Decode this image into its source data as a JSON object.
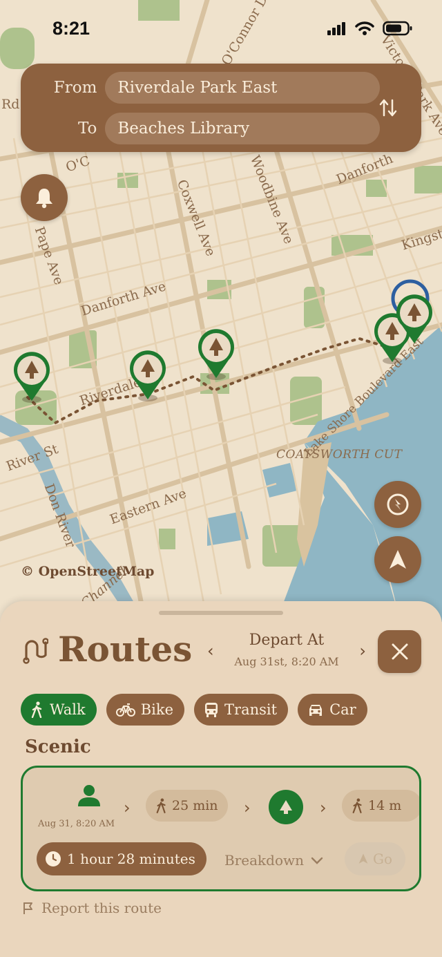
{
  "status": {
    "time": "8:21"
  },
  "route_form": {
    "from_label": "From",
    "from_value": "Riverdale Park East",
    "to_label": "To",
    "to_value": "Beaches Library"
  },
  "map": {
    "attribution": "© OpenStreetMap",
    "street_labels": [
      "Danforth Ave",
      "Coxwell Ave",
      "Danforth",
      "Kingston",
      "Riverdale",
      "River St",
      "Don River",
      "Eastern Ave",
      "Lake Shore Boulevard East",
      "COATSWORTH CUT",
      "Channel",
      "Pape Ave",
      "Woodbine Ave",
      "O'Connor Dr",
      "Victoria Park Ave",
      "Rd",
      "O'C"
    ]
  },
  "sheet": {
    "title": "Routes",
    "depart_title": "Depart At",
    "depart_time": "Aug 31st, 8:20 AM",
    "modes": [
      {
        "label": "Walk",
        "icon": "walk-icon",
        "active": true
      },
      {
        "label": "Bike",
        "icon": "bike-icon",
        "active": false
      },
      {
        "label": "Transit",
        "icon": "bus-icon",
        "active": false
      },
      {
        "label": "Car",
        "icon": "car-icon",
        "active": false
      }
    ],
    "section_label": "Scenic",
    "card": {
      "start_time": "Aug 31, 8:20 AM",
      "leg1": "25 min",
      "leg2": "14 m",
      "duration": "1 hour 28 minutes",
      "breakdown": "Breakdown",
      "go": "Go"
    },
    "report": "Report this route"
  },
  "colors": {
    "brown": "#8d613f",
    "green": "#1f7a2f",
    "map_bg": "#efe2cc",
    "water": "#8fb6c4",
    "park": "#a8c08a"
  }
}
